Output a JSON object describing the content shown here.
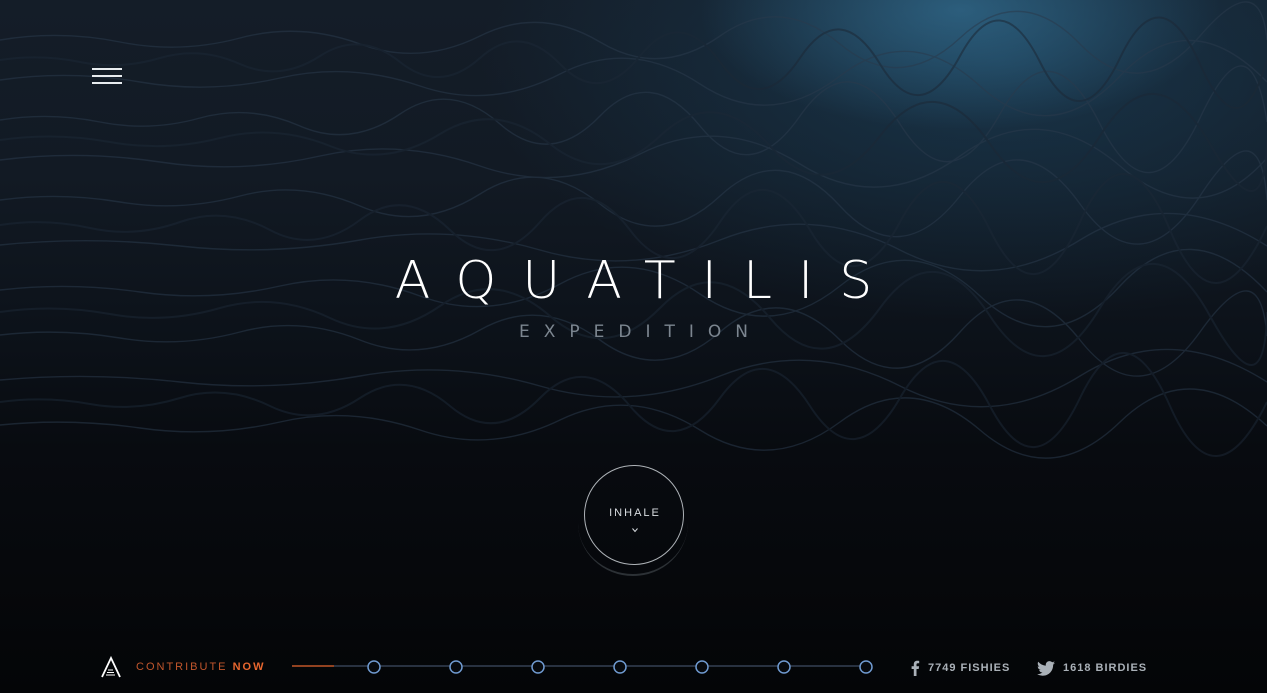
{
  "hero": {
    "title": "AQUATILIS",
    "subtitle": "EXPEDITION",
    "cta_label": "INHALE"
  },
  "footer": {
    "contribute_prefix": "CONTRIBUTE ",
    "contribute_strong": "NOW",
    "timeline_steps": 7,
    "facebook_count_label": "7749 FISHIES",
    "twitter_count_label": "1618 BIRDIES"
  },
  "colors": {
    "accent": "#e8672f",
    "timeline_node": "#6f9ad0",
    "text": "#ffffff"
  },
  "icons": [
    "menu-icon",
    "chevron-down-icon",
    "aquatilis-logo-icon",
    "facebook-icon",
    "twitter-icon"
  ]
}
